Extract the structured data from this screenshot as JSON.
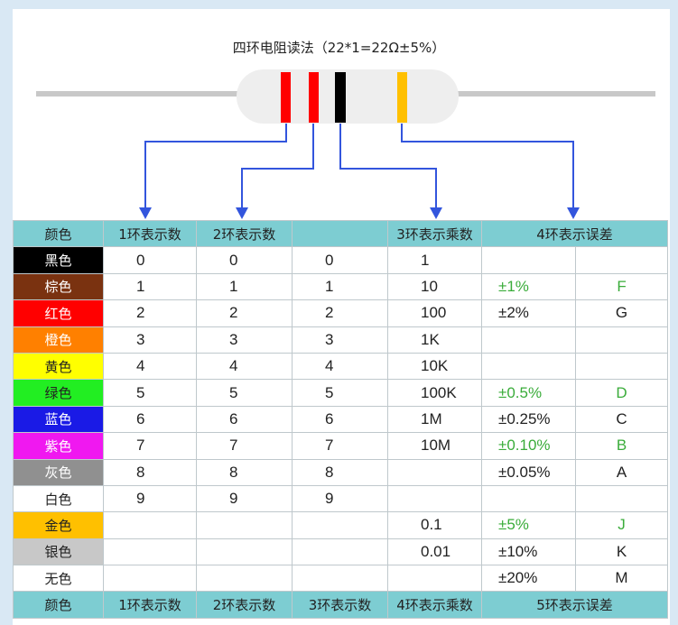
{
  "title": "四环电阻读法（22*1=22Ω±5%）",
  "header": [
    "颜色",
    "1环表示数",
    "2环表示数",
    "",
    "3环表示乘数",
    "4环表示误差"
  ],
  "footer": [
    "颜色",
    "1环表示数",
    "2环表示数",
    "3环表示数",
    "4环表示乘数",
    "5环表示误差"
  ],
  "rows": [
    {
      "color": "黑色",
      "bg": "#000000",
      "fg": "#ffffff",
      "d1": "0",
      "d2": "0",
      "d3": "0",
      "mult": "1",
      "tol": "",
      "code": "",
      "green": false
    },
    {
      "color": "棕色",
      "bg": "#7a3210",
      "fg": "#ffffff",
      "d1": "1",
      "d2": "1",
      "d3": "1",
      "mult": "10",
      "tol": "±1%",
      "code": "F",
      "green": true
    },
    {
      "color": "红色",
      "bg": "#ff0000",
      "fg": "#ffffff",
      "d1": "2",
      "d2": "2",
      "d3": "2",
      "mult": "100",
      "tol": "±2%",
      "code": "G",
      "green": false
    },
    {
      "color": "橙色",
      "bg": "#ff8000",
      "fg": "#ffffff",
      "d1": "3",
      "d2": "3",
      "d3": "3",
      "mult": "1K",
      "tol": "",
      "code": "",
      "green": false
    },
    {
      "color": "黄色",
      "bg": "#ffff00",
      "fg": "#222222",
      "d1": "4",
      "d2": "4",
      "d3": "4",
      "mult": "10K",
      "tol": "",
      "code": "",
      "green": false
    },
    {
      "color": "绿色",
      "bg": "#22ee22",
      "fg": "#222222",
      "d1": "5",
      "d2": "5",
      "d3": "5",
      "mult": "100K",
      "tol": "±0.5%",
      "code": "D",
      "green": true
    },
    {
      "color": "蓝色",
      "bg": "#1a1ae6",
      "fg": "#ffffff",
      "d1": "6",
      "d2": "6",
      "d3": "6",
      "mult": "1M",
      "tol": "±0.25%",
      "code": "C",
      "green": false
    },
    {
      "color": "紫色",
      "bg": "#f018f0",
      "fg": "#ffffff",
      "d1": "7",
      "d2": "7",
      "d3": "7",
      "mult": "10M",
      "tol": "±0.10%",
      "code": "B",
      "green": true
    },
    {
      "color": "灰色",
      "bg": "#909090",
      "fg": "#ffffff",
      "d1": "8",
      "d2": "8",
      "d3": "8",
      "mult": "",
      "tol": "±0.05%",
      "code": "A",
      "green": false
    },
    {
      "color": "白色",
      "bg": "#ffffff",
      "fg": "#222222",
      "d1": "9",
      "d2": "9",
      "d3": "9",
      "mult": "",
      "tol": "",
      "code": "",
      "green": false
    },
    {
      "color": "金色",
      "bg": "#ffc000",
      "fg": "#222222",
      "d1": "",
      "d2": "",
      "d3": "",
      "mult": "0.1",
      "tol": "±5%",
      "code": "J",
      "green": true
    },
    {
      "color": "银色",
      "bg": "#c8c8c8",
      "fg": "#222222",
      "d1": "",
      "d2": "",
      "d3": "",
      "mult": "0.01",
      "tol": "±10%",
      "code": "K",
      "green": false
    },
    {
      "color": "无色",
      "bg": "#ffffff",
      "fg": "#222222",
      "d1": "",
      "d2": "",
      "d3": "",
      "mult": "",
      "tol": "±20%",
      "code": "M",
      "green": false
    }
  ],
  "resistor": {
    "lead_color": "#c8c8c8",
    "body_color": "#eeeeee",
    "arrow_color": "#3355dd",
    "bands": [
      {
        "name": "band-1",
        "color": "#ff0000"
      },
      {
        "name": "band-2",
        "color": "#ff0000"
      },
      {
        "name": "band-3",
        "color": "#000000"
      },
      {
        "name": "band-4",
        "color": "#ffc000"
      }
    ]
  }
}
